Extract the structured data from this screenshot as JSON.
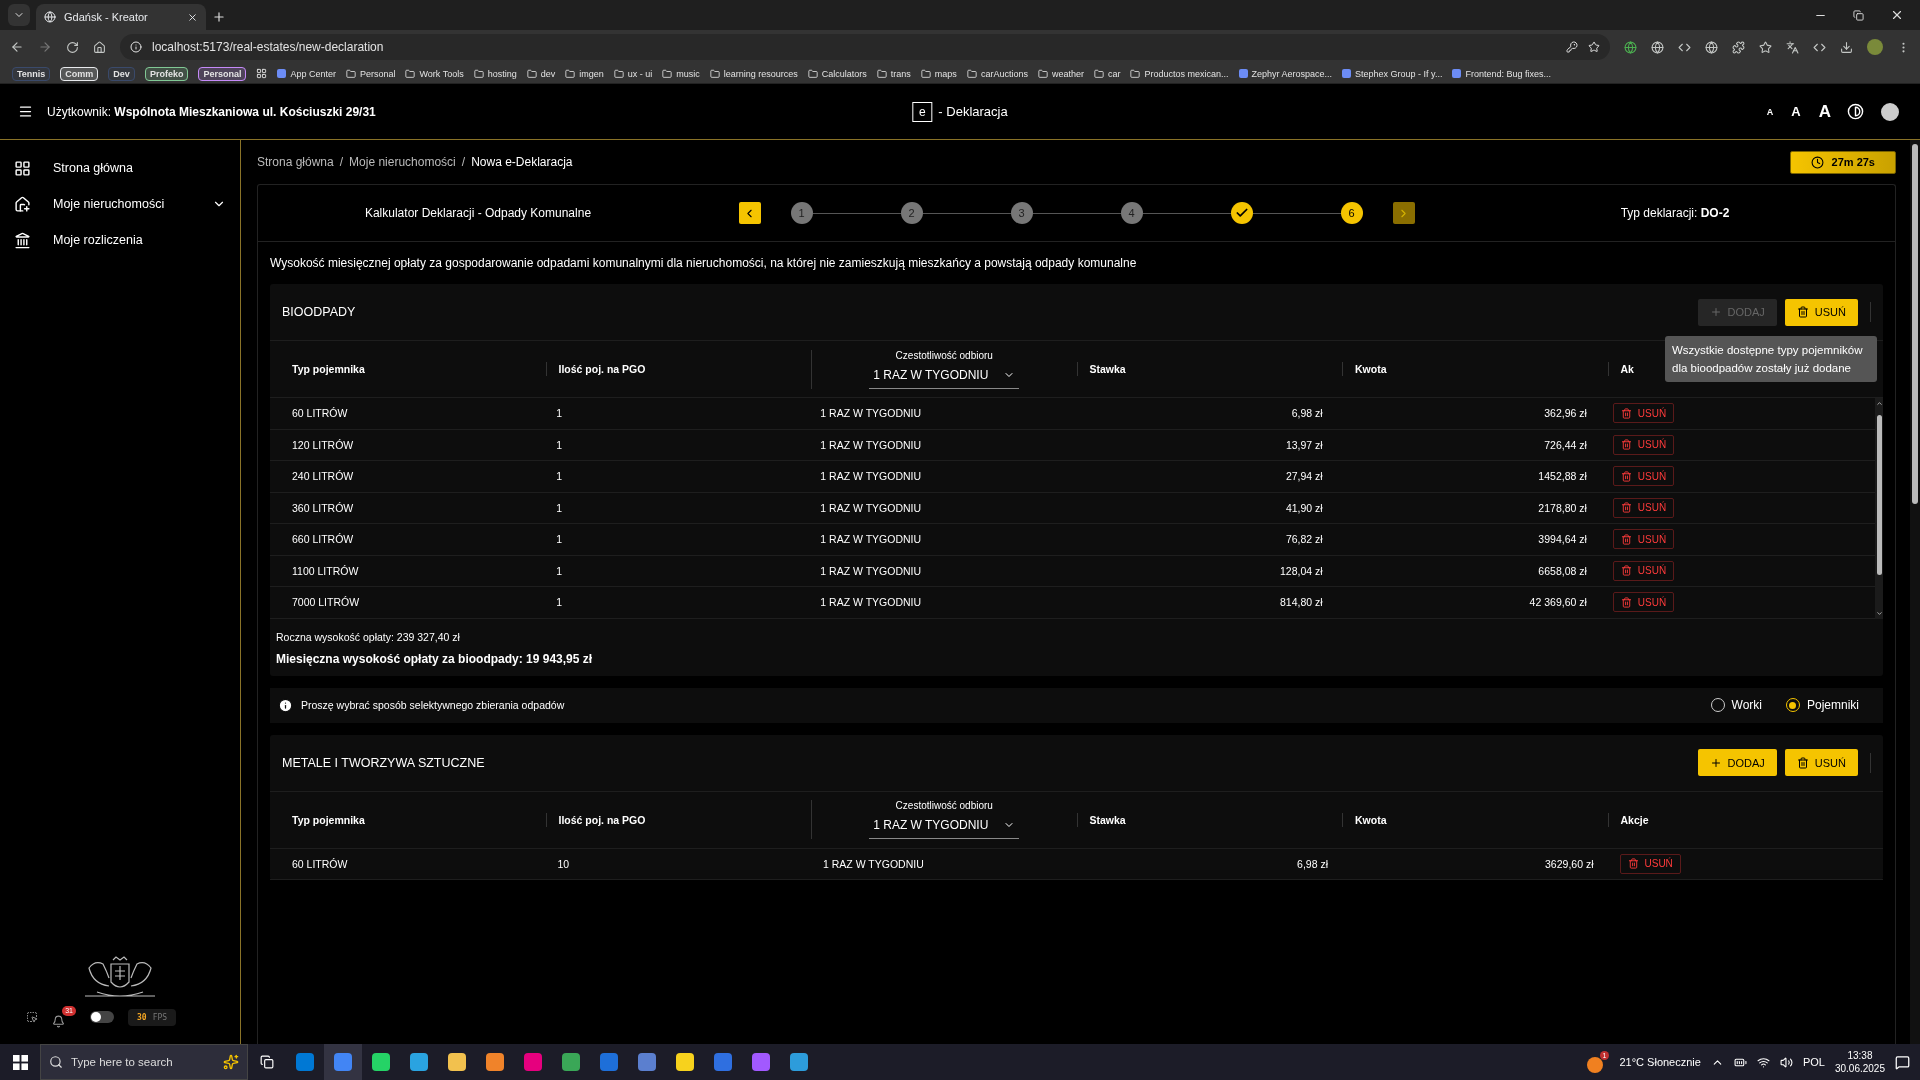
{
  "browser": {
    "tabs": [
      {
        "title": "Gdańsk - Kreator",
        "selected": true
      }
    ],
    "url": "localhost:5173/real-estates/new-declaration",
    "bookmarks": [
      {
        "kind": "chip",
        "label": "Tennis",
        "color": "#3a4a6b"
      },
      {
        "kind": "chip",
        "label": "Comm",
        "color": "#e8eaed"
      },
      {
        "kind": "chip",
        "label": "Dev",
        "color": "#3a4a6b"
      },
      {
        "kind": "chip",
        "label": "Profeko",
        "color": "#81c995"
      },
      {
        "kind": "chip",
        "label": "Personal",
        "color": "#c58af9"
      },
      {
        "kind": "apps"
      },
      {
        "kind": "site",
        "label": "App Center"
      },
      {
        "kind": "folder",
        "label": "Personal"
      },
      {
        "kind": "folder",
        "label": "Work Tools"
      },
      {
        "kind": "folder",
        "label": "hosting"
      },
      {
        "kind": "folder",
        "label": "dev"
      },
      {
        "kind": "folder",
        "label": "imgen"
      },
      {
        "kind": "folder",
        "label": "ux - ui"
      },
      {
        "kind": "folder",
        "label": "music"
      },
      {
        "kind": "folder",
        "label": "learning resources"
      },
      {
        "kind": "folder",
        "label": "Calculators"
      },
      {
        "kind": "folder",
        "label": "trans"
      },
      {
        "kind": "folder",
        "label": "maps"
      },
      {
        "kind": "folder",
        "label": "carAuctions"
      },
      {
        "kind": "folder",
        "label": "weather"
      },
      {
        "kind": "folder",
        "label": "car"
      },
      {
        "kind": "folder",
        "label": "Productos mexican..."
      },
      {
        "kind": "site",
        "label": "Zephyr Aerospace..."
      },
      {
        "kind": "site",
        "label": "Stephex Group - If y..."
      },
      {
        "kind": "site",
        "label": "Frontend: Bug fixes..."
      }
    ]
  },
  "header": {
    "user_label": "Użytkownik:",
    "user_name": "Wspólnota Mieszkaniowa ul. Kościuszki 29/31",
    "logo_letter": "e",
    "title": "- Deklaracja",
    "font_sizes": [
      "A",
      "A",
      "A"
    ]
  },
  "sidebar": {
    "items": [
      {
        "label": "Strona główna",
        "expandable": false
      },
      {
        "label": "Moje nieruchomości",
        "expandable": true
      },
      {
        "label": "Moje rozliczenia",
        "expandable": false
      }
    ],
    "notifications": "31",
    "toggle_on": false,
    "fps": "30",
    "fps_unit": "FPS"
  },
  "breadcrumbs": [
    "Strona główna",
    "Moje nieruchomości",
    "Nowa e-Deklaracja"
  ],
  "breadcrumb_separators": [
    "/",
    "/"
  ],
  "timer": "27m 27s",
  "stepper": {
    "title": "Kalkulator Deklaracji - Odpady Komunalne",
    "steps": [
      {
        "label": "1",
        "completed": false,
        "current": false
      },
      {
        "label": "2",
        "completed": false,
        "current": false
      },
      {
        "label": "3",
        "completed": false,
        "current": false
      },
      {
        "label": "4",
        "completed": false,
        "current": false
      },
      {
        "completed": true
      },
      {
        "label": "6",
        "completed": false,
        "current": true
      }
    ],
    "type_label": "Typ deklaracji:",
    "type_value": "DO-2"
  },
  "description": "Wysokość miesięcznej opłaty za gospodarowanie odpadami komunalnymi dla nieruchomości, na której nie zamieszkują mieszkańcy a powstają odpady komunalne",
  "sections": [
    {
      "title": "BIOODPADY",
      "add_label": "DODAJ",
      "add_disabled": true,
      "remove_label": "USUŃ",
      "tooltip": "Wszystkie dostępne typy pojemników dla bioodpadów zostały już dodane",
      "columns": [
        "Typ pojemnika",
        "Ilość poj. na PGO",
        "Czestotliwość odbioru",
        "Stawka",
        "Kwota",
        "Ak"
      ],
      "frequency_value": "1 RAZ W TYGODNIU",
      "scrollable": true,
      "rows": [
        {
          "type": "60 LITRÓW",
          "count": "1",
          "frequency": "1 RAZ W TYGODNIU",
          "rate": "6,98 zł",
          "amount": "362,96 zł",
          "action": "USUŃ"
        },
        {
          "type": "120 LITRÓW",
          "count": "1",
          "frequency": "1 RAZ W TYGODNIU",
          "rate": "13,97 zł",
          "amount": "726,44 zł",
          "action": "USUŃ"
        },
        {
          "type": "240 LITRÓW",
          "count": "1",
          "frequency": "1 RAZ W TYGODNIU",
          "rate": "27,94 zł",
          "amount": "1452,88 zł",
          "action": "USUŃ"
        },
        {
          "type": "360 LITRÓW",
          "count": "1",
          "frequency": "1 RAZ W TYGODNIU",
          "rate": "41,90 zł",
          "amount": "2178,80 zł",
          "action": "USUŃ"
        },
        {
          "type": "660 LITRÓW",
          "count": "1",
          "frequency": "1 RAZ W TYGODNIU",
          "rate": "76,82 zł",
          "amount": "3994,64 zł",
          "action": "USUŃ"
        },
        {
          "type": "1100 LITRÓW",
          "count": "1",
          "frequency": "1 RAZ W TYGODNIU",
          "rate": "128,04 zł",
          "amount": "6658,08 zł",
          "action": "USUŃ"
        },
        {
          "type": "7000 LITRÓW",
          "count": "1",
          "frequency": "1 RAZ W TYGODNIU",
          "rate": "814,80 zł",
          "amount": "42 369,60 zł",
          "action": "USUŃ"
        }
      ],
      "annual": "Roczna wysokość opłaty: 239 327,40 zł",
      "monthly": "Miesięczna wysokość opłaty za bioodpady: 19 943,95 zł"
    },
    {
      "title": "METALE I TWORZYWA SZTUCZNE",
      "add_label": "DODAJ",
      "add_disabled": false,
      "remove_label": "USUŃ",
      "columns": [
        "Typ pojemnika",
        "Ilość poj. na PGO",
        "Czestotliwość odbioru",
        "Stawka",
        "Kwota",
        "Akcje"
      ],
      "frequency_value": "1 RAZ W TYGODNIU",
      "scrollable": false,
      "rows": [
        {
          "type": "60 LITRÓW",
          "count": "10",
          "frequency": "1 RAZ W TYGODNIU",
          "rate": "6,98 zł",
          "amount": "3629,60 zł",
          "action": "USUŃ"
        }
      ]
    }
  ],
  "collection": {
    "prompt": "Proszę wybrać sposób selektywnego zbierania odpadów",
    "options": [
      {
        "label": "Worki",
        "selected": false
      },
      {
        "label": "Pojemniki",
        "selected": true
      }
    ]
  },
  "taskbar": {
    "search_placeholder": "Type here to search",
    "weather_badge": "1",
    "weather": "21°C Słonecznie",
    "language": "POL",
    "time": "13:38",
    "date": "30.06.2025"
  }
}
